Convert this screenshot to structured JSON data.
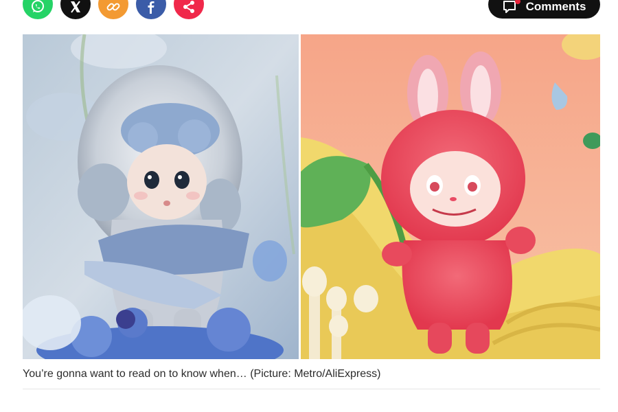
{
  "share": {
    "buttons": [
      {
        "name": "whatsapp",
        "color": "#25d366",
        "icon": "whatsapp-icon"
      },
      {
        "name": "x",
        "color": "#111111",
        "icon": "x-icon"
      },
      {
        "name": "copy-link",
        "color": "#f39a32",
        "icon": "link-icon"
      },
      {
        "name": "facebook",
        "color": "#3b5ca8",
        "icon": "facebook-icon"
      },
      {
        "name": "share",
        "color": "#f0284a",
        "icon": "share-icon"
      }
    ]
  },
  "comments": {
    "label": "Comments",
    "icon": "comment-icon"
  },
  "images": {
    "left": {
      "subject": "blue fluffy toy figure"
    },
    "right": {
      "subject": "pink Labubu toy figure"
    }
  },
  "caption": "You’re gonna want to read on to know when… (Picture: Metro/AliExpress)",
  "colors": {
    "accent_dark": "#111111",
    "caption": "#2b2b2b",
    "notification_dot": "#e8233a"
  }
}
